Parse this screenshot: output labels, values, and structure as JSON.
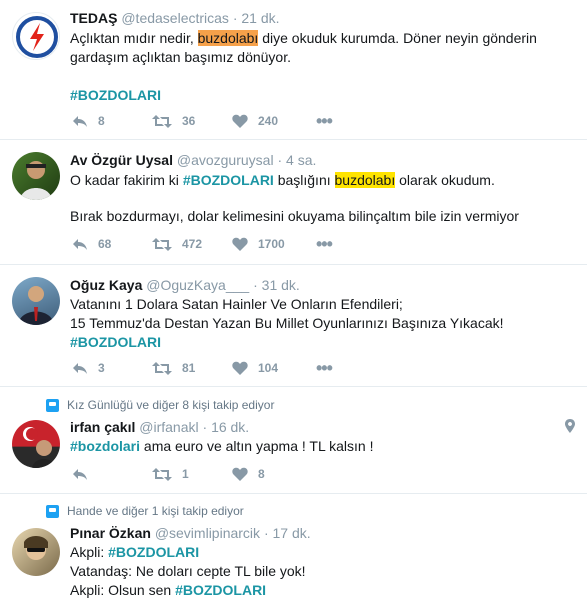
{
  "tweets": [
    {
      "name": "TEDAŞ",
      "handle": "@tedaselectricas",
      "time": "21 dk.",
      "text_a": "Açlıktan mıdır nedir, ",
      "hl": "buzdolabı",
      "text_b": " diye okuduk kurumda. Döner neyin gönderin gardaşım açlıktan başımız dönüyor.",
      "tag": "#BOZDOLARI",
      "replies": "8",
      "retweets": "36",
      "likes": "240"
    },
    {
      "name": "Av Özgür Uysal",
      "handle": "@avozguruysal",
      "time": "4 sa.",
      "text_a": "O kadar fakirim ki ",
      "tag": "#BOZDOLARI",
      "text_b": " başlığını ",
      "hl": "buzdolabı",
      "text_c": " olarak okudum.",
      "text_d": "Bırak bozdurmayı, dolar kelimesini okuyama bilinçaltım bile izin vermiyor",
      "replies": "68",
      "retweets": "472",
      "likes": "1700"
    },
    {
      "name": "Oğuz Kaya",
      "handle": "@OguzKaya___",
      "time": "31 dk.",
      "line1": "Vatanını 1 Dolara Satan Hainler Ve Onların Efendileri;",
      "line2": "15 Temmuz'da Destan Yazan Bu Millet Oyunlarınızı Başınıza Yıkacak!",
      "tag": "#BOZDOLARI",
      "replies": "3",
      "retweets": "81",
      "likes": "104"
    },
    {
      "context": "Kız Günlüğü ve diğer 8 kişi takip ediyor",
      "name": "irfan çakıl",
      "handle": "@irfanakl",
      "time": "16 dk.",
      "tag": "#bozdolari",
      "text_a": " ama euro ve altın yapma ! TL kalsın !",
      "retweets": "1",
      "likes": "8"
    },
    {
      "context": "Hande ve diğer 1 kişi takip ediyor",
      "name": "Pınar Özkan",
      "handle": "@sevimlipinarcik",
      "time": "17 dk.",
      "line1_a": "Akpli: ",
      "tag1": "#BOZDOLARI",
      "line2": "Vatandaş: Ne doları cepte TL bile yok!",
      "line3_a": "Akpli: Olsun sen ",
      "tag3": "#BOZDOLARI"
    }
  ],
  "colors": {
    "hashtag": "#1b95a4",
    "highlight_orange": "#f6a14a",
    "highlight_yellow": "#ffe400",
    "muted": "#8899a6"
  }
}
